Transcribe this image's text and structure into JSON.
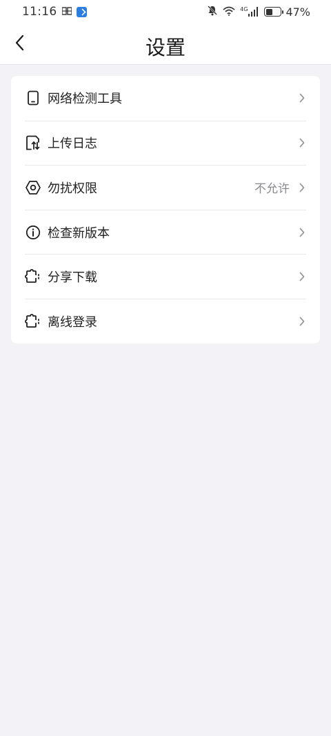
{
  "status_bar": {
    "time": "11:16",
    "network": "4G",
    "battery_pct": "47%",
    "battery_level": 0.47,
    "icons": [
      "notification-app-icon",
      "app-blue-icon",
      "mute-bell-icon",
      "wifi-icon",
      "signal-icon",
      "battery-saver-icon"
    ]
  },
  "header": {
    "title": "设置",
    "back_icon": "chevron-left-icon"
  },
  "settings": {
    "items": [
      {
        "label": "网络检测工具",
        "icon": "phone-device-icon",
        "value": ""
      },
      {
        "label": "上传日志",
        "icon": "upload-log-icon",
        "value": ""
      },
      {
        "label": "勿扰权限",
        "icon": "do-not-disturb-icon",
        "value": "不允许"
      },
      {
        "label": "检查新版本",
        "icon": "info-circle-icon",
        "value": ""
      },
      {
        "label": "分享下载",
        "icon": "puzzle-icon",
        "value": ""
      },
      {
        "label": "离线登录",
        "icon": "puzzle-icon",
        "value": ""
      }
    ]
  },
  "colors": {
    "background": "#f2f2f7",
    "card": "#ffffff",
    "text": "#1f1f1f",
    "secondary_text": "#8a8a8e",
    "chevron": "#9a9a9e"
  }
}
